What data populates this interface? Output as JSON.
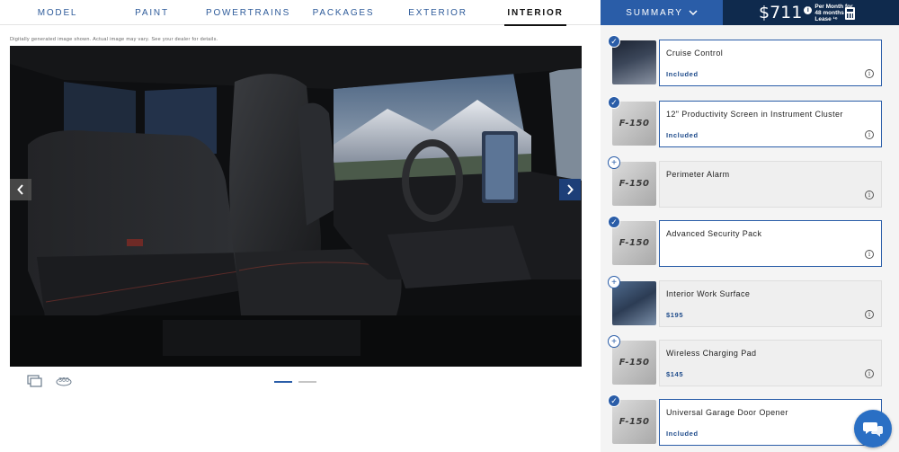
{
  "nav": {
    "tabs": [
      {
        "label": "MODEL"
      },
      {
        "label": "PAINT"
      },
      {
        "label": "POWERTRAINS"
      },
      {
        "label": "PACKAGES"
      },
      {
        "label": "EXTERIOR"
      },
      {
        "label": "INTERIOR",
        "active": true
      }
    ],
    "summary_label": "SUMMARY",
    "price": {
      "amount": "$711",
      "line1": "Per Month for",
      "line2": "48 months",
      "line3": "Lease ¹⁶"
    }
  },
  "gallery": {
    "disclaimer": "Digitally generated image shown. Actual image may vary. See your dealer for details.",
    "view_3d_label": "360",
    "pages": 2,
    "active_page": 0
  },
  "options": [
    {
      "title": "Cruise Control",
      "status": "Included",
      "selected": true,
      "badge": "check",
      "thumb": "photo-dark"
    },
    {
      "title": "12\" Productivity Screen in Instrument Cluster",
      "status": "Included",
      "selected": true,
      "badge": "check",
      "thumb": "logo"
    },
    {
      "title": "Perimeter Alarm",
      "status": "",
      "selected": false,
      "badge": "plus",
      "thumb": "logo"
    },
    {
      "title": "Advanced Security Pack",
      "status": "",
      "selected": true,
      "badge": "check",
      "thumb": "logo"
    },
    {
      "title": "Interior Work Surface",
      "status": "$195",
      "selected": false,
      "badge": "plus",
      "thumb": "photo-laptop"
    },
    {
      "title": "Wireless Charging Pad",
      "status": "$145",
      "selected": false,
      "badge": "plus",
      "thumb": "logo"
    },
    {
      "title": "Universal Garage Door Opener",
      "status": "Included",
      "selected": true,
      "badge": "check",
      "thumb": "logo"
    }
  ],
  "thumb_logo_text": "F-150",
  "colors": {
    "accent": "#2a5da8",
    "navy": "#0f2a4d",
    "chat": "#2a6fc4"
  }
}
